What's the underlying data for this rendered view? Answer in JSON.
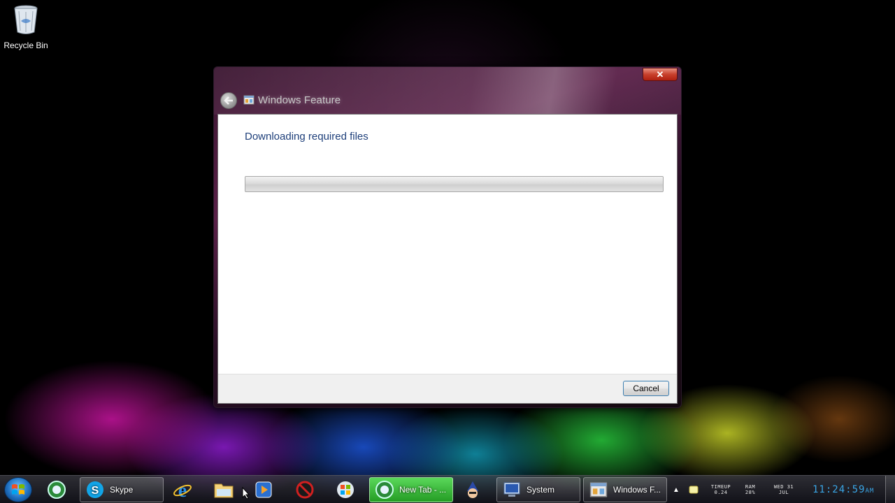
{
  "desktop": {
    "icons": [
      {
        "label": "Recycle Bin",
        "icon": "recycle-bin-icon"
      }
    ]
  },
  "dialog": {
    "title": "Windows Feature",
    "title_icon": "windows-features-icon",
    "close_label": "✕",
    "heading": "Downloading required files",
    "progress_percent": 0,
    "cancel_label": "Cancel"
  },
  "taskbar": {
    "items": [
      {
        "name": "start",
        "icon": "windows-orb-icon",
        "label": ""
      },
      {
        "name": "ie-alt",
        "icon": "browser-globe-icon",
        "label": ""
      },
      {
        "name": "skype",
        "icon": "skype-icon",
        "label": "Skype"
      },
      {
        "name": "ie",
        "icon": "internet-explorer-icon",
        "label": ""
      },
      {
        "name": "explorer",
        "icon": "folder-icon",
        "label": ""
      },
      {
        "name": "media",
        "icon": "media-player-icon",
        "label": ""
      },
      {
        "name": "blocked",
        "icon": "no-symbol-icon",
        "label": ""
      },
      {
        "name": "windows-update",
        "icon": "windows-logo-icon",
        "label": ""
      },
      {
        "name": "new-tab",
        "icon": "browser-globe-icon",
        "label": "New Tab - ..."
      },
      {
        "name": "wizard",
        "icon": "wizard-icon",
        "label": ""
      },
      {
        "name": "system",
        "icon": "system-icon",
        "label": "System"
      },
      {
        "name": "windows-features",
        "icon": "windows-features-icon",
        "label": "Windows F..."
      }
    ],
    "tray": {
      "timeup_label": "TIMEUP",
      "timeup_value": "0.24",
      "ram_label": "RAM",
      "ram_value": "28%",
      "date_day": "WED 31",
      "date_month": "JUL",
      "clock_time": "11:24:59",
      "clock_ampm": "AM"
    }
  },
  "colors": {
    "heading": "#1e3f7a",
    "clock": "#3aa6e6",
    "active_task": "#34b534",
    "close_button": "#c8402c"
  }
}
